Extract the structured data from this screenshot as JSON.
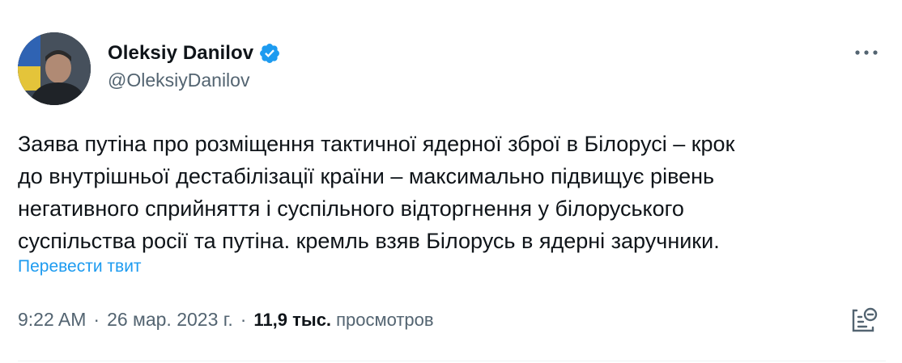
{
  "tweet": {
    "author": {
      "display_name": "Oleksiy Danilov",
      "handle": "@OleksiyDanilov",
      "verified": true
    },
    "text": "Заява путіна про розміщення тактичної ядерної зброї в Білорусі – крок\nдо внутрішньої дестабілізації країни – максимально підвищує рівень\nнегативного сприйняття і суспільного відторгнення у білоруського\nсуспільства росії та путіна. кремль взяв Білорусь в ядерні заручники.",
    "translate_label": "Перевести твит",
    "time": "9:22 AM",
    "separator": "·",
    "date": "26 мар. 2023 г.",
    "views_count": "11,9 тыс.",
    "views_label": "просмотров"
  },
  "icons": {
    "verified": "verified-badge-icon",
    "more": "more-horizontal-icon",
    "analytics": "analytics-icon"
  },
  "colors": {
    "text": "#0f1419",
    "secondary": "#536471",
    "accent": "#1d9bf0"
  }
}
